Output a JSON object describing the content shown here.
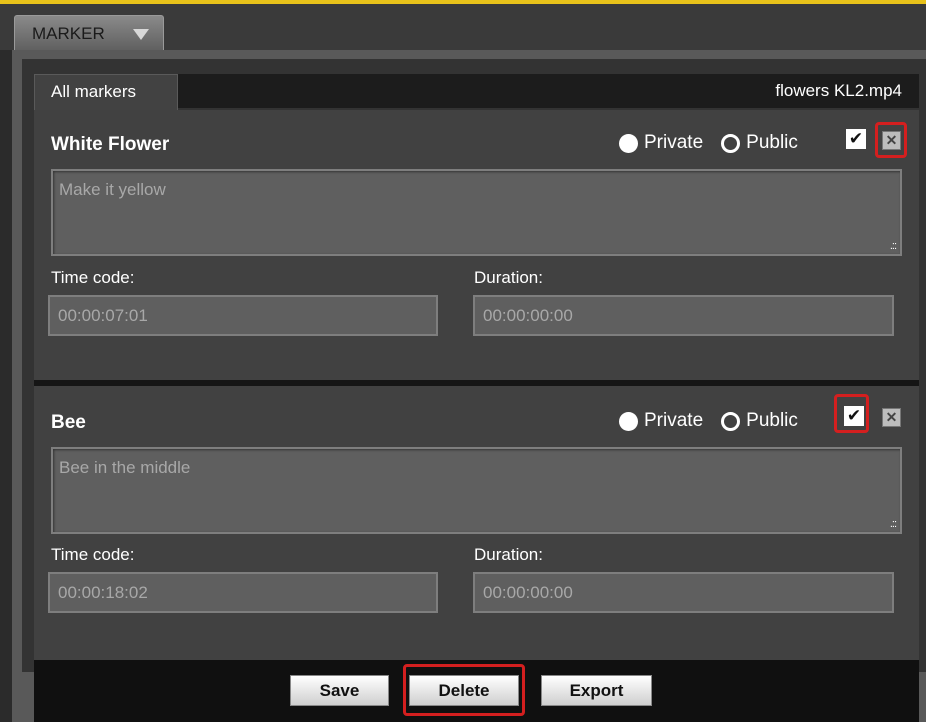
{
  "panel": {
    "tab_label": "MARKER",
    "tab_icon": "chevron-down-icon"
  },
  "tabs": {
    "active": "All markers"
  },
  "file": {
    "name": "flowers KL2.mp4"
  },
  "markers": [
    {
      "title": "White Flower",
      "private_label": "Private",
      "public_label": "Public",
      "note": "Make it yellow",
      "timecode_label": "Time code:",
      "timecode": "00:00:07:01",
      "duration_label": "Duration:",
      "duration": "00:00:00:00"
    },
    {
      "title": "Bee",
      "private_label": "Private",
      "public_label": "Public",
      "note": "Bee in the middle",
      "timecode_label": "Time code:",
      "timecode": "00:00:18:02",
      "duration_label": "Duration:",
      "duration": "00:00:00:00"
    }
  ],
  "buttons": {
    "save": "Save",
    "delete": "Delete",
    "export": "Export"
  },
  "colors": {
    "accent_top": "#e8c21a",
    "highlight": "#d41f1f"
  }
}
